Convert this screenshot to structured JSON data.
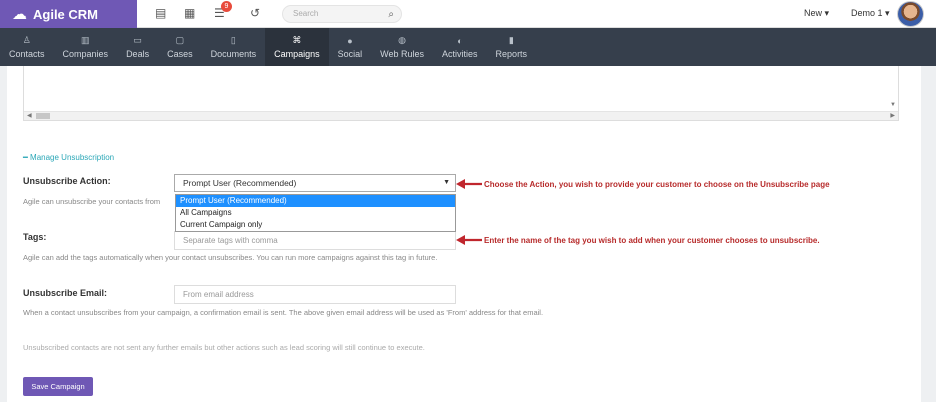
{
  "brand": {
    "name": "Agile CRM"
  },
  "topbar": {
    "badge_count": "9",
    "search_placeholder": "Search",
    "new_label": "New ▾",
    "user_label": "Demo 1 ▾"
  },
  "nav": {
    "items": [
      {
        "label": "Contacts",
        "icon": "person-icon"
      },
      {
        "label": "Companies",
        "icon": "building-icon"
      },
      {
        "label": "Deals",
        "icon": "money-icon"
      },
      {
        "label": "Cases",
        "icon": "folder-icon"
      },
      {
        "label": "Documents",
        "icon": "document-icon"
      },
      {
        "label": "Campaigns",
        "icon": "sitemap-icon"
      },
      {
        "label": "Social",
        "icon": "chat-icon"
      },
      {
        "label": "Web Rules",
        "icon": "globe-icon"
      },
      {
        "label": "Activities",
        "icon": "activity-icon"
      },
      {
        "label": "Reports",
        "icon": "bar-chart-icon"
      }
    ],
    "active": "Campaigns"
  },
  "form": {
    "manage_link": "Manage Unsubscription",
    "unsubscribe_action_label": "Unsubscribe Action:",
    "unsubscribe_action_value": "Prompt User (Recommended)",
    "unsubscribe_action_help": "Agile can unsubscribe your contacts from",
    "options": [
      "Prompt User (Recommended)",
      "All Campaigns",
      "Current Campaign only"
    ],
    "tags_label": "Tags:",
    "tags_placeholder": "Separate tags with comma",
    "tags_help": "Agile can add the tags automatically when your contact unsubscribes. You can run more campaigns against this tag in future.",
    "email_label": "Unsubscribe Email:",
    "email_placeholder": "From email address",
    "email_help": "When a contact unsubscribes from your campaign, a confirmation email is sent. The above given email address will be used as 'From' address for that email.",
    "footer_note": "Unsubscribed contacts are not sent any further emails but other actions such as lead scoring will still continue to execute.",
    "save_label": "Save Campaign"
  },
  "annotations": {
    "action": "Choose the Action, you wish to provide your customer to choose on the Unsubscribe page",
    "tags": "Enter the name of the tag you wish to add when your customer chooses to unsubscribe."
  },
  "colors": {
    "brand": "#6f58b5",
    "nav_bg": "#363f4c",
    "annotation": "#b72b2b",
    "link": "#2ba7b7",
    "highlight": "#1e90ff"
  }
}
